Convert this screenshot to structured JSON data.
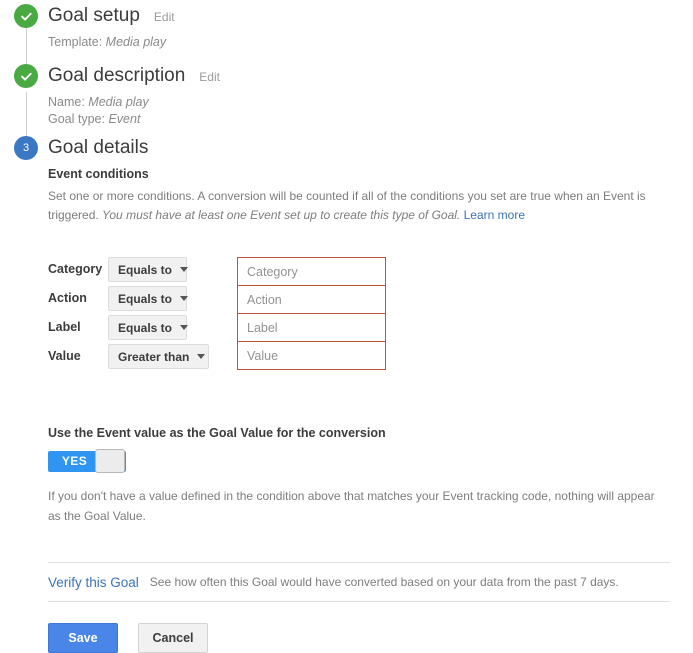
{
  "stepper": {
    "steps": [
      {
        "marker": "check",
        "title": "Goal setup",
        "edit_label": "Edit",
        "sub_prefix": "Template: ",
        "sub_value": "Media play"
      },
      {
        "marker": "check",
        "title": "Goal description",
        "edit_label": "Edit",
        "sub_line1_prefix": "Name: ",
        "sub_line1_value": "Media play",
        "sub_line2_prefix": "Goal type: ",
        "sub_line2_value": "Event"
      },
      {
        "marker": "3",
        "title": "Goal details"
      }
    ]
  },
  "details": {
    "section_title": "Event conditions",
    "helper_text_1": "Set one or more conditions. A conversion will be counted if all of the conditions you set are true when an Event is triggered. ",
    "helper_text_italic": "must have at least one Event set up to create this type of Goal.",
    "helper_text_italic_lead": "You",
    "learn_more_label": "Learn more",
    "conditions": [
      {
        "label": "Category",
        "operator": "Equals to",
        "placeholder": "Category",
        "value": ""
      },
      {
        "label": "Action",
        "operator": "Equals to",
        "placeholder": "Action",
        "value": ""
      },
      {
        "label": "Label",
        "operator": "Equals to",
        "placeholder": "Label",
        "value": ""
      },
      {
        "label": "Value",
        "operator": "Greater than",
        "placeholder": "Value",
        "value": ""
      }
    ]
  },
  "event_value": {
    "title": "Use the Event value as the Goal Value for the conversion",
    "toggle_on_label": "YES",
    "toggle_state": "on",
    "helper": "If you don't have a value defined in the condition above that matches your Event tracking code, nothing will appear as the Goal Value."
  },
  "verify": {
    "link_label": "Verify this Goal",
    "description": "See how often this Goal would have converted based on your data from the past 7 days."
  },
  "actions": {
    "save_label": "Save",
    "cancel_label": "Cancel"
  },
  "colors": {
    "step_done": "#49A942",
    "step_active": "#3B78C3",
    "link": "#3b73b9",
    "input_error_border": "#c0513f",
    "toggle_on": "#2f95f0",
    "primary_button": "#4a86e8"
  }
}
